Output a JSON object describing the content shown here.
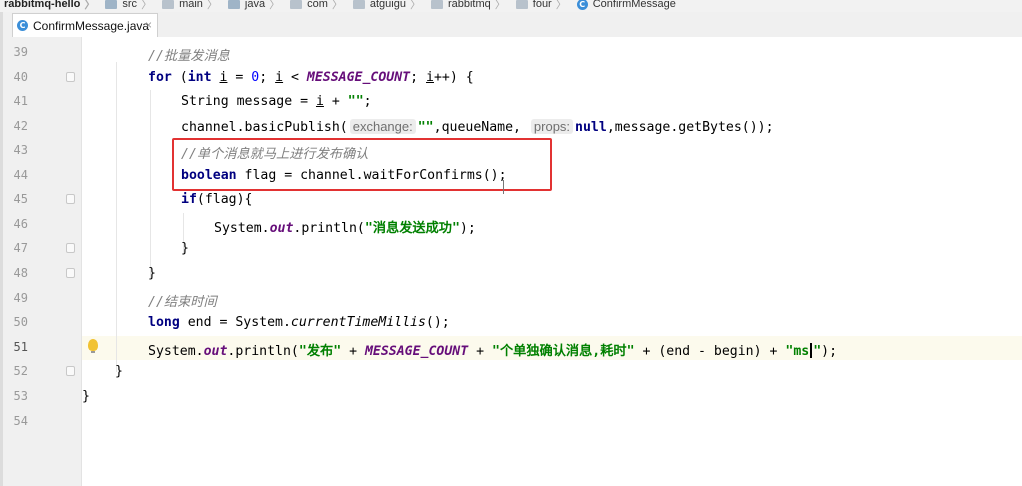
{
  "breadcrumb": {
    "items": [
      "rabbitmq-hello",
      "src",
      "main",
      "java",
      "com",
      "atguigu",
      "rabbitmq",
      "four",
      "ConfirmMessage"
    ]
  },
  "tab": {
    "label": "ConfirmMessage.java",
    "close": "×"
  },
  "icons": {
    "class_icon_letter": "C"
  },
  "colors": {
    "keyword": "#000080",
    "string": "#008000",
    "comment": "#808080",
    "constant": "#660e7a",
    "number": "#0000ff",
    "highlight_box": "#e23232"
  },
  "editor": {
    "current_line": "51",
    "lines": [
      {
        "n": "39",
        "t": {
          "a": "//批量发消息"
        }
      },
      {
        "n": "40",
        "t": {
          "a": "for",
          "b": " (",
          "c": "int",
          "d": " ",
          "e": "i",
          "f": " = ",
          "g": "0",
          "h": "; ",
          "i": "i",
          "j": " < ",
          "k": "MESSAGE_COUNT",
          "l": "; ",
          "m": "i",
          "o": "++) {"
        }
      },
      {
        "n": "41",
        "t": {
          "a": "String message = ",
          "b": "i",
          "c": " + ",
          "d": "\"\"",
          "e": ";"
        }
      },
      {
        "n": "42",
        "t": {
          "a": "channel.basicPublish(",
          "b": "exchange:",
          "c": "\"\"",
          "d": ",queueName, ",
          "e": "props:",
          "f": "null",
          "g": ",message.getBytes());"
        }
      },
      {
        "n": "43",
        "t": {
          "a": "//单个消息就马上进行发布确认"
        }
      },
      {
        "n": "44",
        "t": {
          "a": "boolean",
          "b": " flag = channel.waitForConfirms",
          "c": "()",
          "d": ";"
        }
      },
      {
        "n": "45",
        "t": {
          "a": "if",
          "b": "(flag){"
        }
      },
      {
        "n": "46",
        "t": {
          "a": "System.",
          "b": "out",
          "c": ".println(",
          "d": "\"消息发送成功\"",
          "e": ");"
        }
      },
      {
        "n": "47",
        "t": {
          "a": "}"
        }
      },
      {
        "n": "48",
        "t": {
          "a": "}"
        }
      },
      {
        "n": "49",
        "t": {
          "a": "//结束时间"
        }
      },
      {
        "n": "50",
        "t": {
          "a": "long",
          "b": " end = System.",
          "c": "currentTimeMillis",
          "d": "();"
        }
      },
      {
        "n": "51",
        "t": {
          "a": "System.",
          "b": "out",
          "c": ".println(",
          "d": "\"发布\"",
          "e": " + ",
          "f": "MESSAGE_COUNT",
          "g": " + ",
          "h": "\"个单独确认消息,耗时\"",
          "i": " + (end - begin) + ",
          "j": "\"ms",
          "k": "\"",
          "l": ");"
        }
      },
      {
        "n": "52",
        "t": {
          "a": "}"
        }
      },
      {
        "n": "53",
        "t": {
          "a": "}"
        }
      },
      {
        "n": "54",
        "t": {}
      }
    ]
  }
}
